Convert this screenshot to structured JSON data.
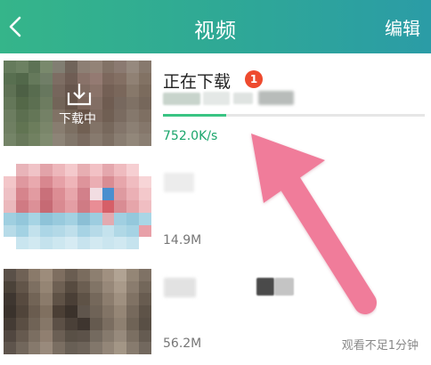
{
  "header": {
    "title": "视频",
    "edit_label": "编辑",
    "background": "#2fa995"
  },
  "items": [
    {
      "status_overlay": "下载中",
      "name": "正在下载",
      "badge_count": "1",
      "progress": 0.24,
      "speed": "752.0K/s"
    },
    {
      "size": "14.9M"
    },
    {
      "size": "56.2M",
      "watch_note": "观看不足1分钟"
    }
  ],
  "colors": {
    "accent_green": "#39c483",
    "badge_red": "#ee4a2e",
    "arrow_pink": "#f07c9a"
  },
  "icons": [
    "back-arrow-icon",
    "download-icon"
  ]
}
